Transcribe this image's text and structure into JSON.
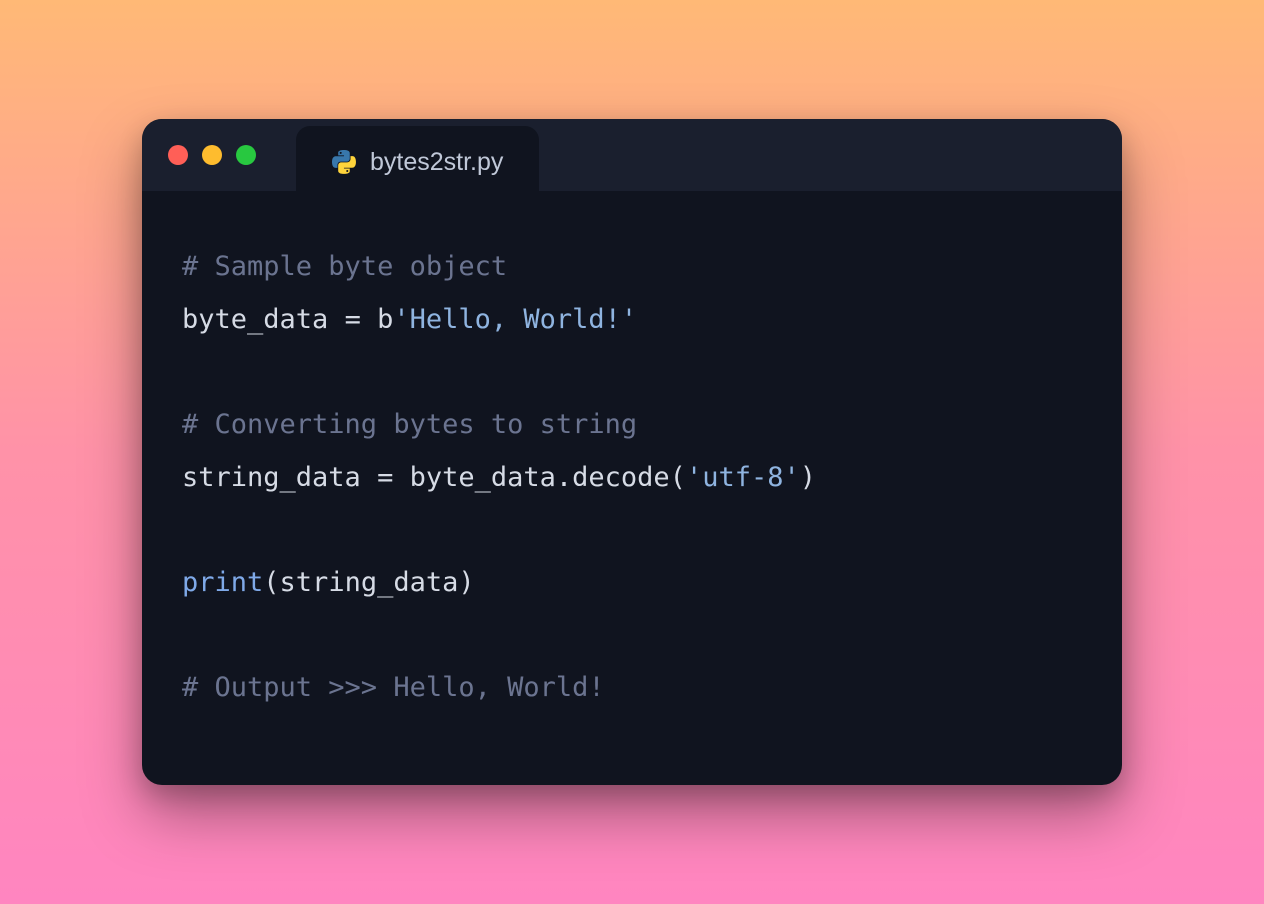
{
  "tab": {
    "filename": "bytes2str.py"
  },
  "code": {
    "line1_comment": "# Sample byte object",
    "line2_var": "byte_data ",
    "line2_eq": "= ",
    "line2_prefix": "b",
    "line2_string": "'Hello, World!'",
    "line4_comment": "# Converting bytes to string",
    "line5_var": "string_data ",
    "line5_eq": "= ",
    "line5_expr": "byte_data.decode(",
    "line5_arg": "'utf-8'",
    "line5_close": ")",
    "line7_builtin": "print",
    "line7_open": "(",
    "line7_arg": "string_data",
    "line7_close": ")",
    "line9_comment": "# Output >>> Hello, World!"
  }
}
